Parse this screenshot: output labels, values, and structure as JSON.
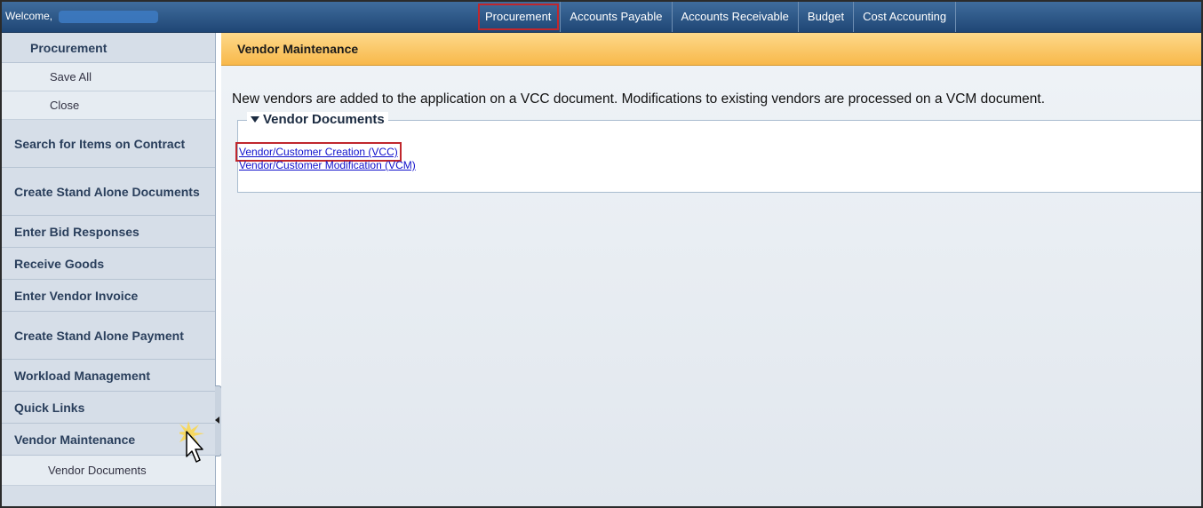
{
  "topbar": {
    "welcome": "Welcome,",
    "nav": [
      "Procurement",
      "Accounts Payable",
      "Accounts Receivable",
      "Budget",
      "Cost Accounting"
    ],
    "active_nav": "Procurement"
  },
  "sidebar": {
    "header": "Procurement",
    "subitems": [
      "Save All",
      "Close"
    ],
    "items": [
      "Search for Items on Contract",
      "Create Stand Alone Documents",
      "Enter Bid Responses",
      "Receive Goods",
      "Enter Vendor Invoice",
      "Create Stand Alone Payment",
      "Workload Management",
      "Quick Links",
      "Vendor Maintenance"
    ],
    "vendor_sub": "Vendor Documents"
  },
  "main": {
    "title": "Vendor Maintenance",
    "intro": "New vendors are added to the application on a VCC document. Modifications to existing vendors are processed on a VCM document.",
    "panel": {
      "legend": "Vendor Documents",
      "links": [
        "Vendor/Customer Creation (VCC)",
        "Vendor/Customer Modification (VCM)"
      ]
    }
  },
  "colors": {
    "topbar": "#1f4675",
    "header_accent": "#f8b84a",
    "highlight": "#c0272d",
    "link": "#1010cc"
  }
}
